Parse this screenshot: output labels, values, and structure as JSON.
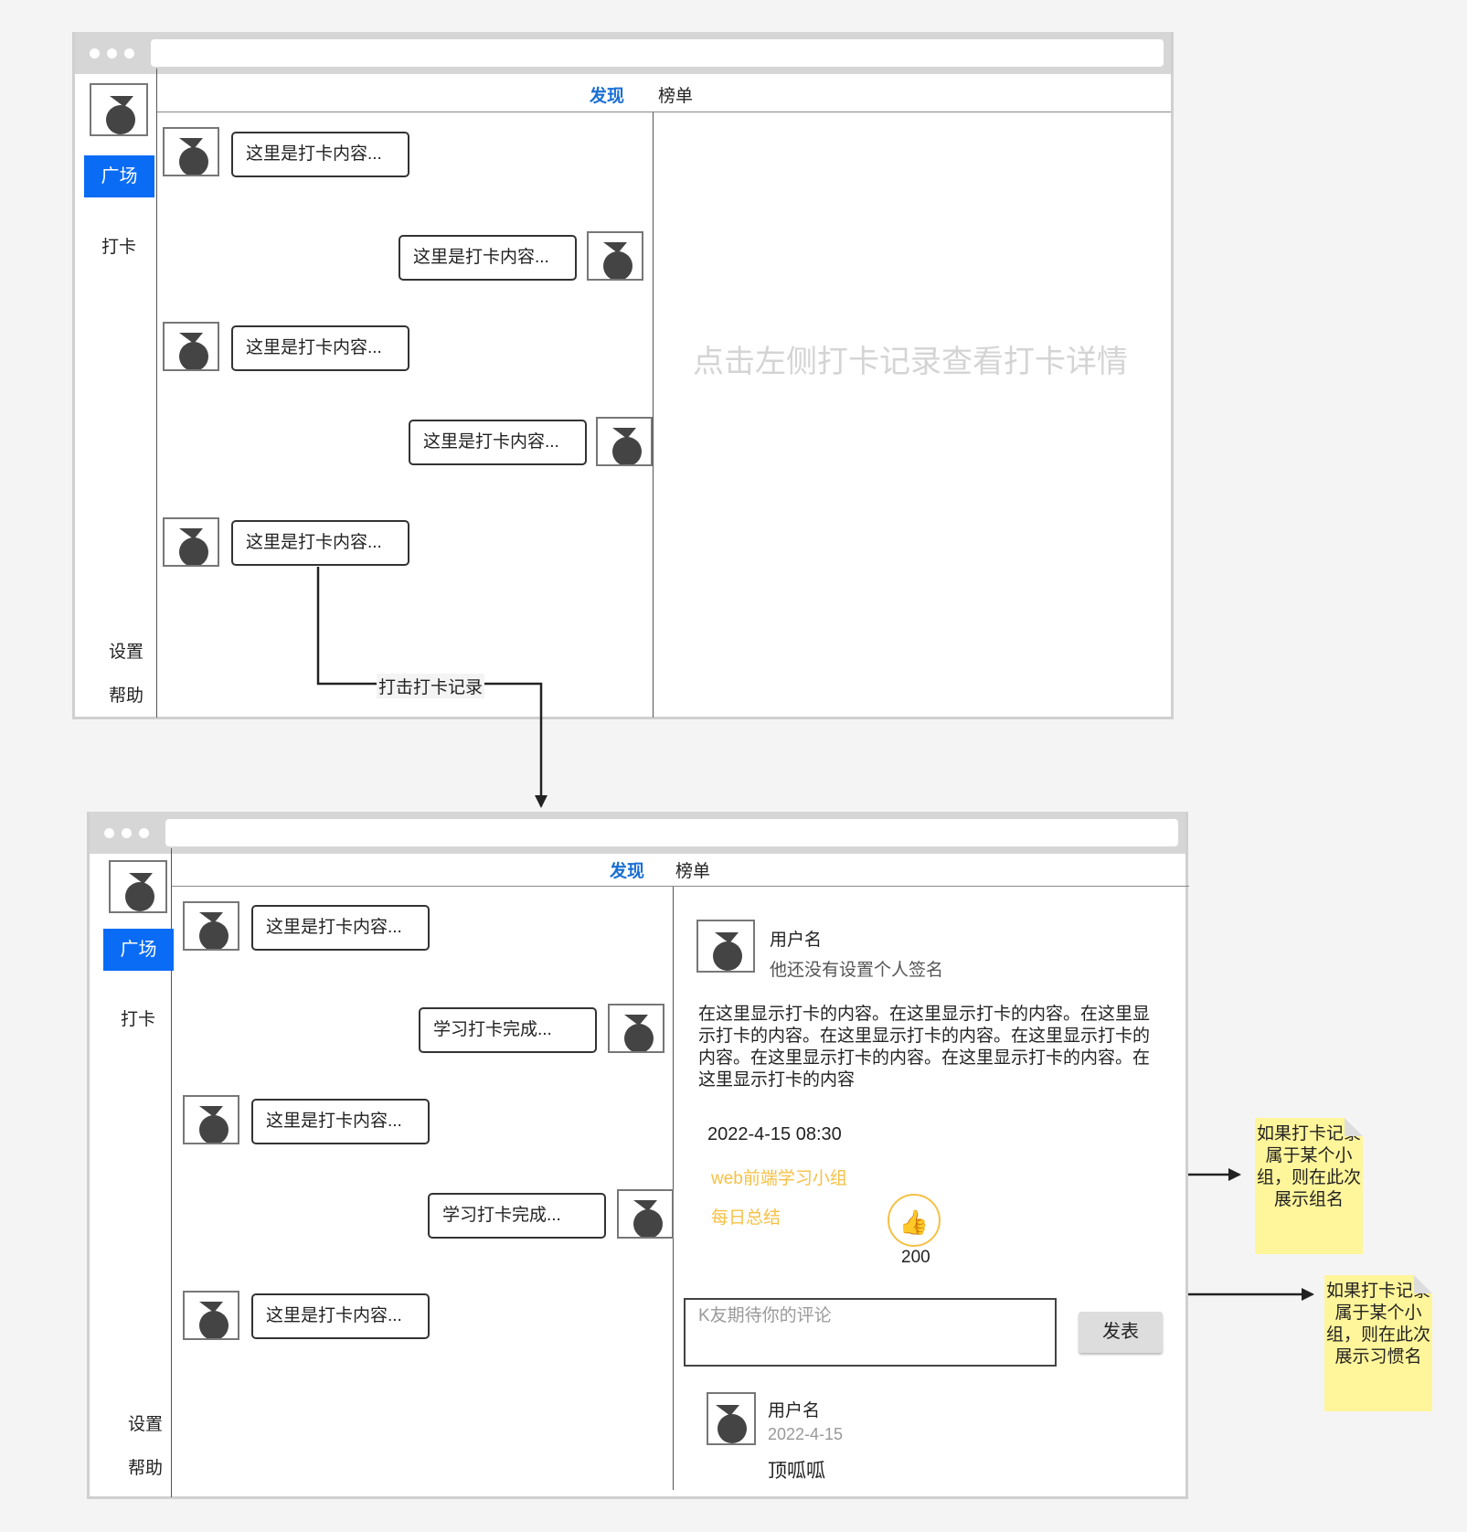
{
  "window1": {
    "nav": {
      "discover": "发现",
      "ranking": "榜单"
    },
    "sidebar": {
      "plaza": "广场",
      "checkin": "打卡",
      "settings": "设置",
      "help": "帮助"
    },
    "posts": [
      "这里是打卡内容...",
      "这里是打卡内容...",
      "这里是打卡内容...",
      "这里是打卡内容...",
      "这里是打卡内容..."
    ],
    "placeholder": "点击左侧打卡记录查看打卡详情"
  },
  "arrow_label": "打击打卡记录",
  "window2": {
    "nav": {
      "discover": "发现",
      "ranking": "榜单"
    },
    "sidebar": {
      "plaza": "广场",
      "checkin": "打卡",
      "settings": "设置",
      "help": "帮助"
    },
    "posts": [
      "这里是打卡内容...",
      "学习打卡完成...",
      "这里是打卡内容...",
      "学习打卡完成...",
      "这里是打卡内容..."
    ],
    "detail": {
      "username": "用户名",
      "signature": "他还没有设置个人签名",
      "content": "在这里显示打卡的内容。在这里显示打卡的内容。在这里显示打卡的内容。在这里显示打卡的内容。在这里显示打卡的内容。在这里显示打卡的内容。在这里显示打卡的内容。在这里显示打卡的内容",
      "datetime": "2022-4-15 08:30",
      "group": "web前端学习小组",
      "habit": "每日总结",
      "like_icon": "👍",
      "like_count": "200",
      "comment_placeholder": "K友期待你的评论",
      "submit": "发表",
      "comment": {
        "username": "用户名",
        "date": "2022-4-15",
        "text": "顶呱呱"
      }
    }
  },
  "notes": {
    "group_note": "如果打卡记录属于某个小组，则在此次展示组名",
    "habit_note": "如果打卡记录属于某个小组，则在此次展示习惯名"
  },
  "colors": {
    "accent": "#0a6cf5",
    "nav_active": "#1a6fd4",
    "tag": "#f5c045",
    "note_bg": "#fff59a"
  }
}
